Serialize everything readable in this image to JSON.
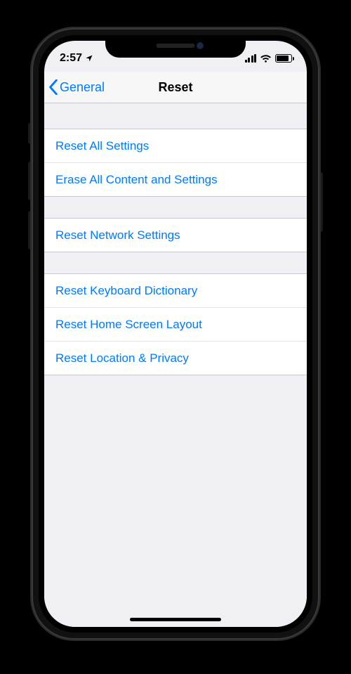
{
  "status": {
    "time": "2:57",
    "location_services": true
  },
  "nav": {
    "back_label": "General",
    "title": "Reset"
  },
  "groups": [
    {
      "items": [
        {
          "id": "reset-all",
          "label": "Reset All Settings"
        },
        {
          "id": "erase-all",
          "label": "Erase All Content and Settings"
        }
      ]
    },
    {
      "items": [
        {
          "id": "reset-network",
          "label": "Reset Network Settings"
        }
      ]
    },
    {
      "items": [
        {
          "id": "reset-keyboard",
          "label": "Reset Keyboard Dictionary"
        },
        {
          "id": "reset-home",
          "label": "Reset Home Screen Layout"
        },
        {
          "id": "reset-location",
          "label": "Reset Location & Privacy"
        }
      ]
    }
  ],
  "colors": {
    "tint": "#007aff",
    "background": "#efeff4",
    "row_bg": "#ffffff",
    "separator": "#c8c7cc"
  }
}
